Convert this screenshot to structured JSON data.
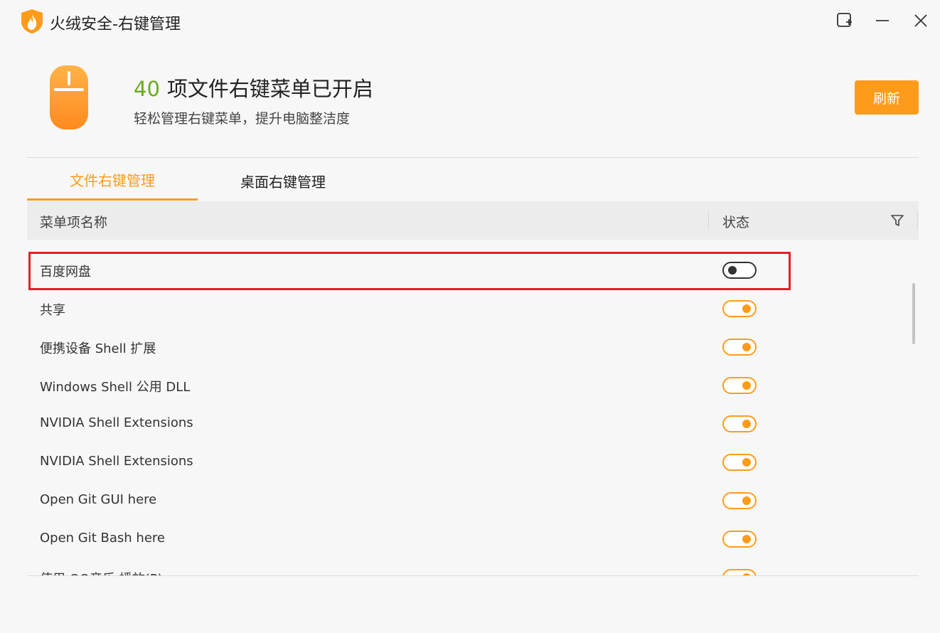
{
  "window": {
    "title": "火绒安全-右键管理",
    "logo_icon": "huorong-shield-flame-icon",
    "controls": [
      "new-window-icon",
      "minimize-icon",
      "close-icon"
    ]
  },
  "header": {
    "count": "40",
    "headline": "项文件右键菜单已开启",
    "subtitle": "轻松管理右键菜单，提升电脑整洁度",
    "refresh_label": "刷新",
    "illustration_icon": "mouse-icon"
  },
  "tabs": [
    {
      "label": "文件右键管理",
      "active": true
    },
    {
      "label": "桌面右键管理",
      "active": false
    }
  ],
  "table": {
    "col_name": "菜单项名称",
    "col_status": "状态",
    "filter_icon": "filter-icon",
    "rows": [
      {
        "label": "百度网盘",
        "enabled": false,
        "highlighted": true
      },
      {
        "label": "共享",
        "enabled": true
      },
      {
        "label": "便携设备 Shell 扩展",
        "enabled": true
      },
      {
        "label": "Windows Shell 公用 DLL",
        "enabled": true
      },
      {
        "label": "NVIDIA Shell Extensions",
        "enabled": true
      },
      {
        "label": "NVIDIA Shell Extensions",
        "enabled": true
      },
      {
        "label": "Open Git GUI here",
        "enabled": true
      },
      {
        "label": "Open Git Bash here",
        "enabled": true
      },
      {
        "label": "使用 QQ音乐 播放(P)",
        "enabled": true
      }
    ]
  },
  "colors": {
    "accent": "#ff9b1a",
    "count_green": "#6aa823",
    "highlight_red": "#e0202a"
  }
}
